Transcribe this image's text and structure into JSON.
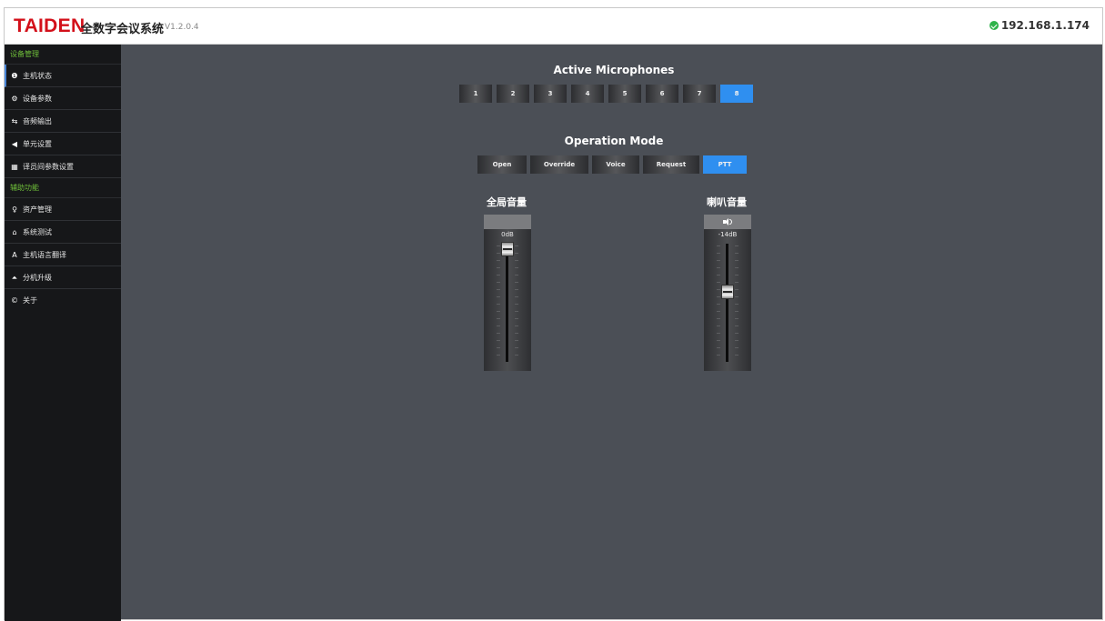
{
  "header": {
    "brand": "TAIDEN",
    "app_title": "全数字会议系统",
    "version": "V1.2.0.4",
    "ip": "192.168.1.174",
    "status_icon": "check-circle-icon",
    "brand_color": "#d3101a"
  },
  "sidebar": {
    "section1_label": "设备管理",
    "section1_items": [
      {
        "label": "主机状态",
        "icon": "info-icon",
        "glyph": "❶"
      },
      {
        "label": "设备参数",
        "icon": "gears-icon",
        "glyph": "⚙"
      },
      {
        "label": "音频输出",
        "icon": "audio-out-icon",
        "glyph": "⇆"
      },
      {
        "label": "单元设置",
        "icon": "volume-icon",
        "glyph": "◀"
      },
      {
        "label": "译员间参数设置",
        "icon": "bank-icon",
        "glyph": "▦"
      }
    ],
    "section2_label": "辅助功能",
    "section2_items": [
      {
        "label": "资产管理",
        "icon": "map-marker-icon",
        "glyph": "♀"
      },
      {
        "label": "系统测试",
        "icon": "home-icon",
        "glyph": "⌂"
      },
      {
        "label": "主机语言翻译",
        "icon": "font-icon",
        "glyph": "A"
      },
      {
        "label": "分机升级",
        "icon": "user-upload-icon",
        "glyph": "⏶"
      },
      {
        "label": "关于",
        "icon": "copyright-icon",
        "glyph": "©"
      }
    ],
    "section_color": "#6fbf3a"
  },
  "main": {
    "active_mics_title": "Active Microphones",
    "mic_buttons": [
      "1",
      "2",
      "3",
      "4",
      "5",
      "6",
      "7",
      "8"
    ],
    "mic_selected": "8",
    "operation_mode_title": "Operation Mode",
    "mode_buttons": [
      "Open",
      "Override",
      "Voice",
      "Request",
      "PTT"
    ],
    "mode_selected": "PTT",
    "accent_color": "#2f8ff0",
    "global_volume": {
      "label": "全局音量",
      "value_label": "0dB",
      "level": 1.0
    },
    "speaker_volume": {
      "label": "喇叭音量",
      "value_label": "-14dB",
      "icon": "speaker-icon",
      "level": 0.6
    }
  }
}
